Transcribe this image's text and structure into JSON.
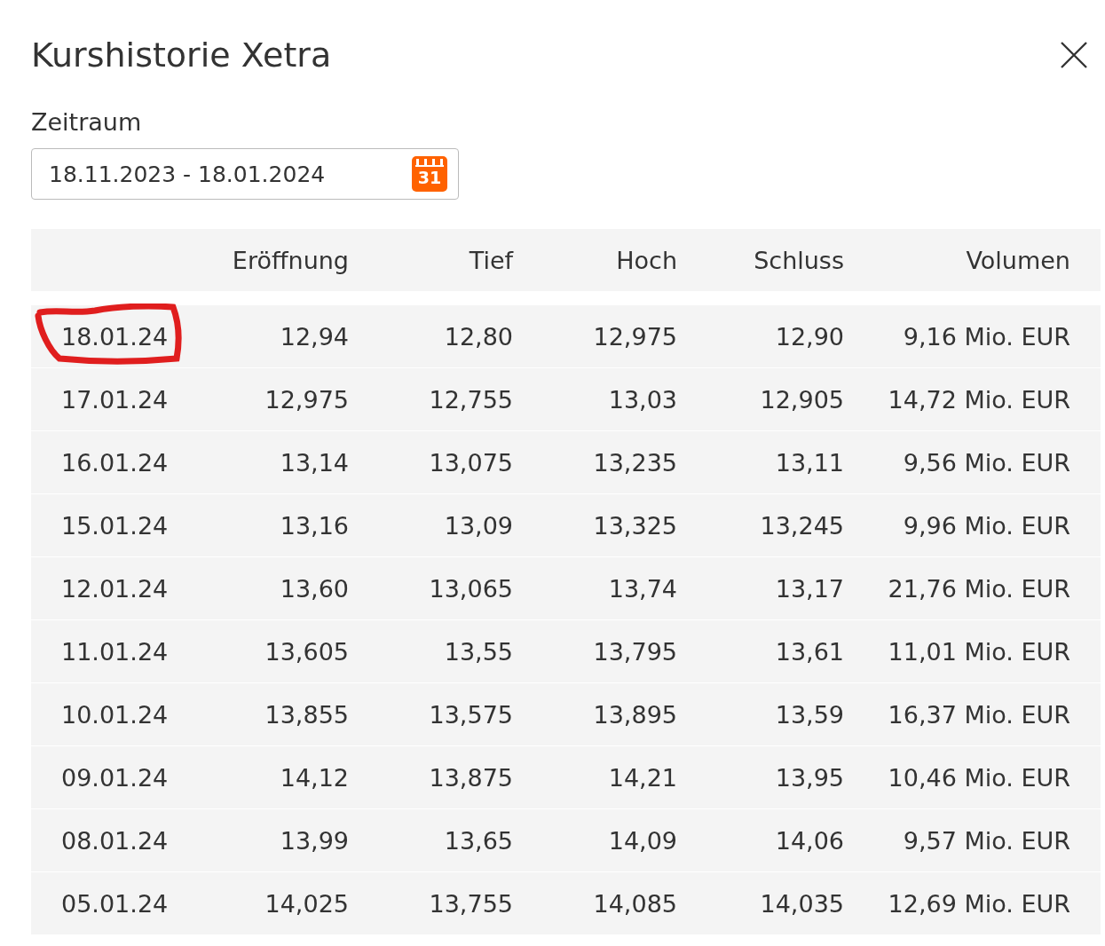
{
  "dialog": {
    "title": "Kurshistorie Xetra"
  },
  "period": {
    "label": "Zeitraum",
    "value": "18.11.2023 - 18.01.2024",
    "calendar_day": "31"
  },
  "table": {
    "columns": [
      "",
      "Eröffnung",
      "Tief",
      "Hoch",
      "Schluss",
      "Volumen"
    ],
    "rows": [
      {
        "cells": [
          "18.01.24",
          "12,94",
          "12,80",
          "12,975",
          "12,90",
          "9,16 Mio. EUR"
        ],
        "circled": true
      },
      {
        "cells": [
          "17.01.24",
          "12,975",
          "12,755",
          "13,03",
          "12,905",
          "14,72 Mio. EUR"
        ],
        "circled": false
      },
      {
        "cells": [
          "16.01.24",
          "13,14",
          "13,075",
          "13,235",
          "13,11",
          "9,56 Mio. EUR"
        ],
        "circled": false
      },
      {
        "cells": [
          "15.01.24",
          "13,16",
          "13,09",
          "13,325",
          "13,245",
          "9,96 Mio. EUR"
        ],
        "circled": false
      },
      {
        "cells": [
          "12.01.24",
          "13,60",
          "13,065",
          "13,74",
          "13,17",
          "21,76 Mio. EUR"
        ],
        "circled": false
      },
      {
        "cells": [
          "11.01.24",
          "13,605",
          "13,55",
          "13,795",
          "13,61",
          "11,01 Mio. EUR"
        ],
        "circled": false
      },
      {
        "cells": [
          "10.01.24",
          "13,855",
          "13,575",
          "13,895",
          "13,59",
          "16,37 Mio. EUR"
        ],
        "circled": false
      },
      {
        "cells": [
          "09.01.24",
          "14,12",
          "13,875",
          "14,21",
          "13,95",
          "10,46 Mio. EUR"
        ],
        "circled": false
      },
      {
        "cells": [
          "08.01.24",
          "13,99",
          "13,65",
          "14,09",
          "14,06",
          "9,57 Mio. EUR"
        ],
        "circled": false
      },
      {
        "cells": [
          "05.01.24",
          "14,025",
          "13,755",
          "14,085",
          "14,035",
          "12,69 Mio. EUR"
        ],
        "circled": false
      }
    ]
  }
}
